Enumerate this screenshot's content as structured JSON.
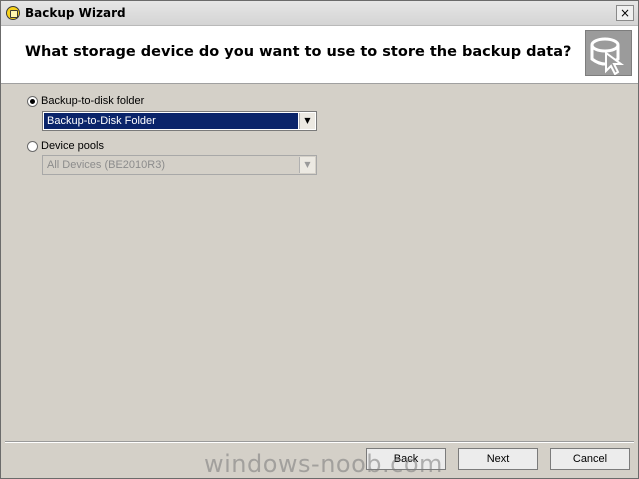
{
  "window": {
    "title": "Backup Wizard",
    "close_label": "×"
  },
  "header": {
    "question": "What storage device do you want to use to store the backup data?"
  },
  "options": [
    {
      "label": "Backup-to-disk folder",
      "checked": true,
      "combo_value": "Backup-to-Disk Folder",
      "combo_enabled": true
    },
    {
      "label": "Device pools",
      "checked": false,
      "combo_value": "All Devices (BE2010R3)",
      "combo_enabled": false
    }
  ],
  "buttons": {
    "back": "Back",
    "next": "Next",
    "cancel": "Cancel"
  },
  "watermark": "windows-noob.com",
  "combo_arrow": "▼",
  "colors": {
    "selection": "#0a246a",
    "dialog_background": "#d4d0c8"
  }
}
